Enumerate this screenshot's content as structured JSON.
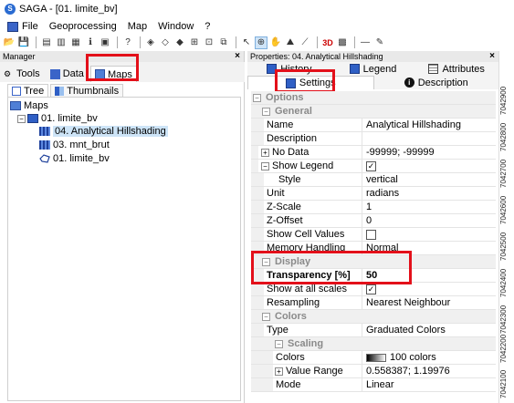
{
  "window": {
    "title": "SAGA - [01. limite_bv]"
  },
  "menu": [
    "File",
    "Geoprocessing",
    "Map",
    "Window",
    "?"
  ],
  "manager": {
    "title": "Manager",
    "close": "×",
    "tabs": {
      "tools": "Tools",
      "data": "Data",
      "maps": "Maps"
    },
    "subtabs": {
      "tree": "Tree",
      "thumbnails": "Thumbnails"
    },
    "tree": {
      "root": "Maps",
      "map": "01. limite_bv",
      "layers": [
        "04. Analytical Hillshading",
        "03. mnt_brut",
        "01. limite_bv"
      ]
    }
  },
  "properties": {
    "title": "Properties: 04. Analytical Hillshading",
    "close": "×",
    "tabs_row1": {
      "history": "History",
      "legend": "Legend",
      "attributes": "Attributes"
    },
    "tabs_row2": {
      "settings": "Settings",
      "description": "Description"
    },
    "categories": {
      "options": "Options",
      "general": "General",
      "display": "Display",
      "colors": "Colors",
      "scaling": "Scaling"
    },
    "general": {
      "name": {
        "label": "Name",
        "value": "Analytical Hillshading"
      },
      "description": {
        "label": "Description",
        "value": ""
      },
      "nodata": {
        "label": "No Data",
        "value": "-99999; -99999"
      },
      "show_legend": {
        "label": "Show Legend",
        "value": "✓"
      },
      "style": {
        "label": "Style",
        "value": "vertical"
      },
      "unit": {
        "label": "Unit",
        "value": "radians"
      },
      "zscale": {
        "label": "Z-Scale",
        "value": "1"
      },
      "zoffset": {
        "label": "Z-Offset",
        "value": "0"
      },
      "show_cell_values": {
        "label": "Show Cell Values",
        "value": ""
      },
      "memory_handling": {
        "label": "Memory Handling",
        "value": "Normal"
      }
    },
    "display": {
      "transparency": {
        "label": "Transparency [%]",
        "value": "50"
      },
      "show_all_scales": {
        "label": "Show at all scales",
        "value": "✓"
      },
      "resampling": {
        "label": "Resampling",
        "value": "Nearest Neighbour"
      }
    },
    "colors": {
      "type": {
        "label": "Type",
        "value": "Graduated Colors"
      },
      "colors": {
        "label": "Colors",
        "value": "100 colors"
      },
      "value_range": {
        "label": "Value Range",
        "value": "0.558387; 1.19976"
      },
      "mode": {
        "label": "Mode",
        "value": "Linear"
      }
    }
  },
  "map_axis_labels": [
    "7042900",
    "7042800",
    "7042700",
    "7042600",
    "7042500",
    "7042400",
    "7042300",
    "7042200",
    "7042100"
  ],
  "accent": {
    "highlight": "#e3101a",
    "selection": "#cde4f7"
  }
}
